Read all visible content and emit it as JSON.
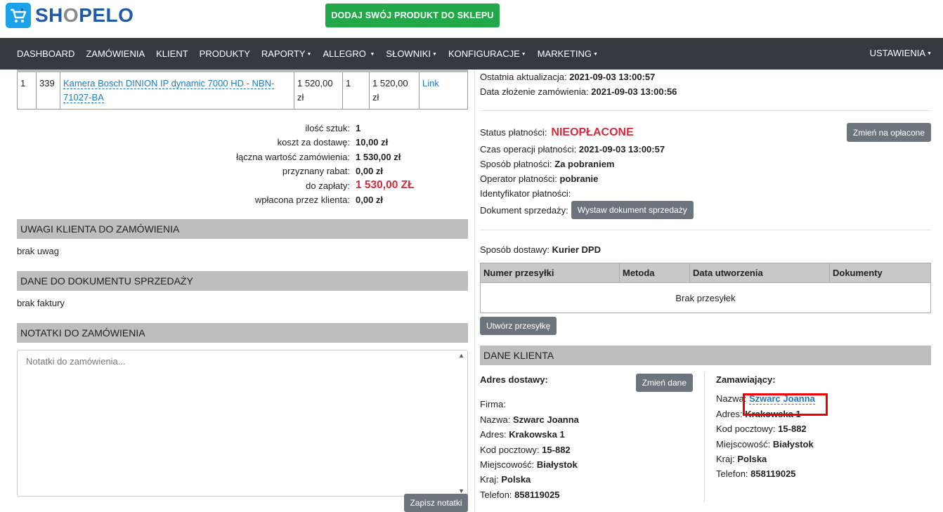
{
  "header": {
    "logo_text_pre": "SH",
    "logo_text_o": "O",
    "logo_text_post": "PELO",
    "add_product_label": "DODAJ SWÓJ PRODUKT DO SKLEPU"
  },
  "nav": {
    "items": [
      {
        "label": "DASHBOARD",
        "dropdown": false
      },
      {
        "label": "ZAMÓWIENIA",
        "dropdown": false
      },
      {
        "label": "KLIENT",
        "dropdown": false
      },
      {
        "label": "PRODUKTY",
        "dropdown": false
      },
      {
        "label": "RAPORTY",
        "dropdown": true
      },
      {
        "label": "ALLEGRO",
        "dropdown": true
      },
      {
        "label": "SŁOWNIKI",
        "dropdown": true
      },
      {
        "label": "KONFIGURACJE",
        "dropdown": true
      },
      {
        "label": "MARKETING",
        "dropdown": true
      }
    ],
    "settings": "USTAWIENIA"
  },
  "products": {
    "rows": [
      {
        "no": "1",
        "id": "339",
        "name": "Kamera Bosch DINION IP dynamic 7000 HD - NBN-71027-BA",
        "price": "1 520,00 zł",
        "qty": "1",
        "total": "1 520,00 zł",
        "link": "Link"
      }
    ]
  },
  "summary": {
    "qty_label": "ilość sztuk:",
    "qty": "1",
    "shipping_label": "koszt za dostawę:",
    "shipping": "10,00 zł",
    "total_label": "łączna wartość zamówienia:",
    "total": "1 530,00 zł",
    "discount_label": "przyznany rabat:",
    "discount": "0,00 zł",
    "topay_label": "do zapłaty:",
    "topay": "1 530,00 ZŁ",
    "paid_label": "wpłacona przez klienta:",
    "paid": "0,00 zł"
  },
  "sections": {
    "remarks_title": "UWAGI KLIENTA DO ZAMÓWIENIA",
    "remarks_text": "brak uwag",
    "invoice_title": "DANE DO DOKUMENTU SPRZEDAŻY",
    "invoice_text": "brak faktury",
    "notes_title": "NOTATKI DO ZAMÓWIENIA",
    "notes_placeholder": "Notatki do zamówienia...",
    "save_notes": "Zapisz notatki"
  },
  "order_info": {
    "last_update_label": "Ostatnia aktualizacja:",
    "last_update": "2021-09-03 13:00:57",
    "created_label": "Data złożenie zamówienia:",
    "created": "2021-09-03 13:00:56"
  },
  "payment": {
    "status_label": "Status płatności:",
    "status": "NIEOPŁACONE",
    "change_btn": "Zmień na opłacone",
    "time_label": "Czas operacji płatności:",
    "time": "2021-09-03 13:00:57",
    "method_label": "Sposób płatności:",
    "method": "Za pobraniem",
    "operator_label": "Operator płatności:",
    "operator": "pobranie",
    "id_label": "Identyfikator płatności:",
    "doc_label": "Dokument sprzedaży:",
    "doc_btn": "Wystaw dokument sprzedaży"
  },
  "shipping": {
    "method_label": "Sposób dostawy:",
    "method": "Kurier DPD",
    "columns": [
      "Numer przesyłki",
      "Metoda",
      "Data utworzenia",
      "Dokumenty"
    ],
    "empty": "Brak przesyłek",
    "create_btn": "Utwórz przesyłkę"
  },
  "client": {
    "title": "DANE KLIENTA",
    "delivery_header": "Adres dostawy:",
    "change_btn": "Zmień dane",
    "company_label": "Firma:",
    "name_label": "Nazwa:",
    "name": "Szwarc Joanna",
    "address_label": "Adres:",
    "address": "Krakowska 1",
    "zip_label": "Kod pocztowy:",
    "zip": "15-882",
    "city_label": "Miejscowość:",
    "city": "Białystok",
    "country_label": "Kraj:",
    "country": "Polska",
    "phone_label": "Telefon:",
    "phone": "858119025",
    "orderer_header": "Zamawiający:"
  }
}
